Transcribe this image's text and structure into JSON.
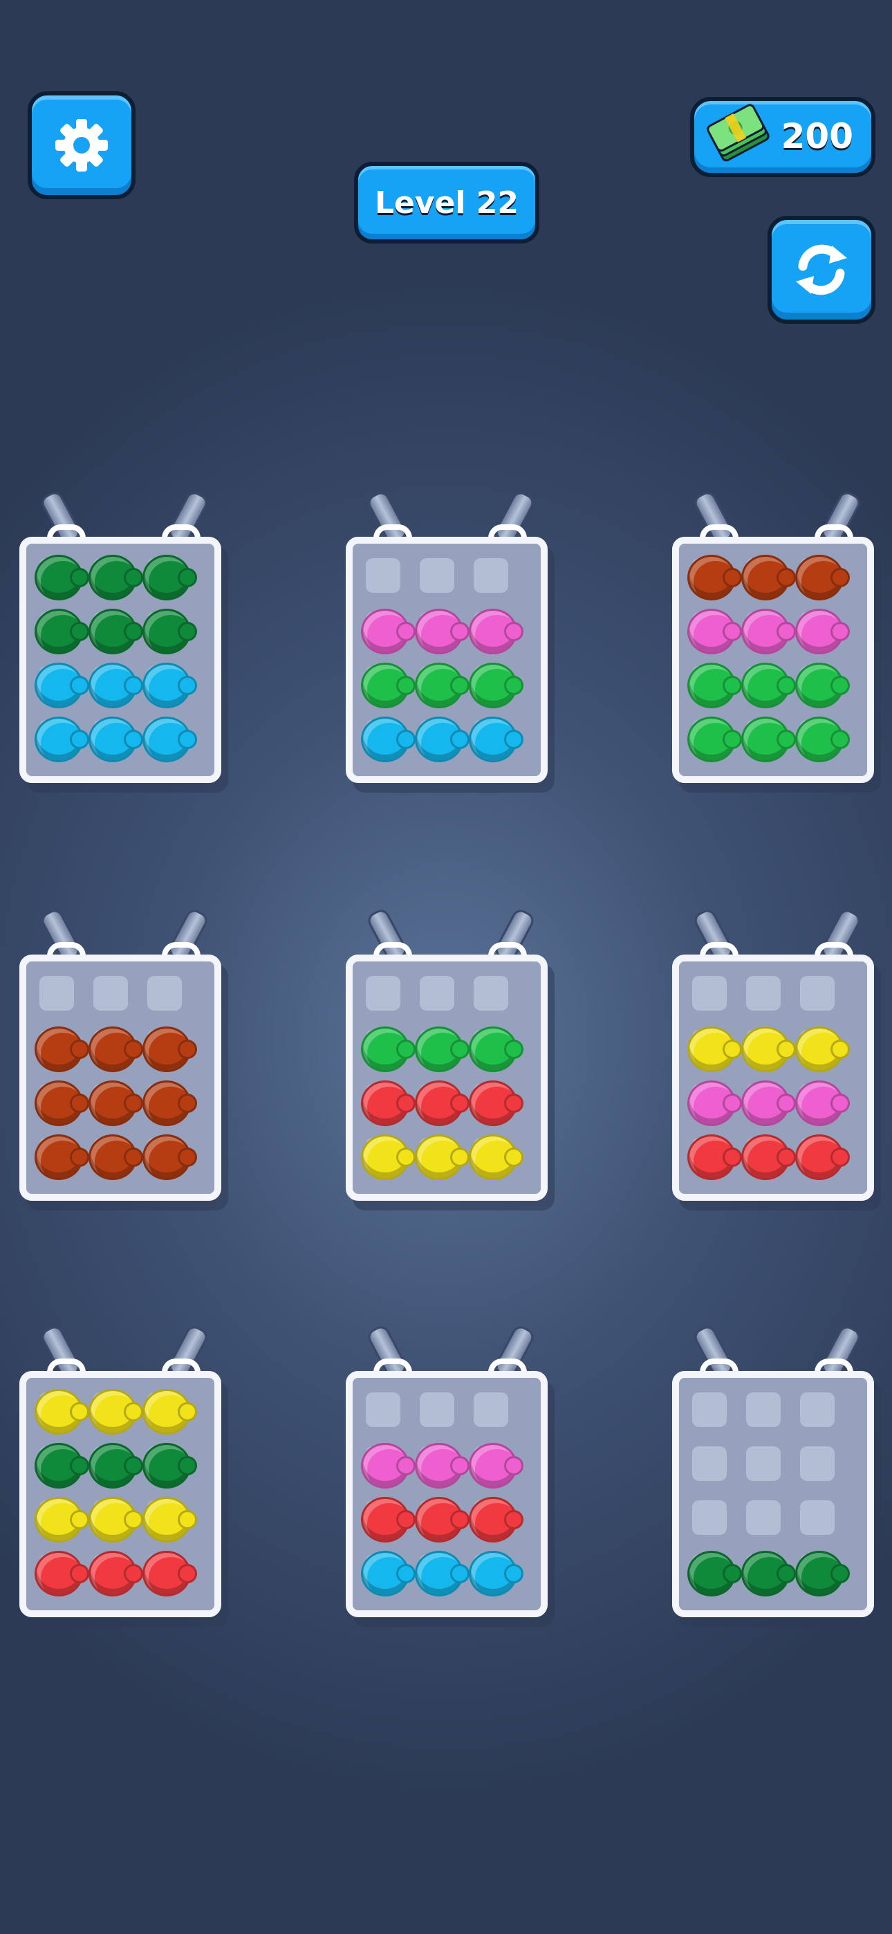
{
  "hud": {
    "level_label": "Level 22",
    "cash_amount": "200",
    "settings_icon": "gear-icon",
    "restart_icon": "refresh-icon",
    "cash_icon": "cash-stack-icon"
  },
  "colors": {
    "green": "#0f8a3a",
    "lime": "#1fc04a",
    "cyan": "#15b8ee",
    "pink": "#ee5fd0",
    "brown": "#b63d12",
    "red": "#f03a3f",
    "yellow": "#f2e21a"
  },
  "boards": [
    {
      "rows": [
        [
          "green",
          "green",
          "green"
        ],
        [
          "green",
          "green",
          "green"
        ],
        [
          "cyan",
          "cyan",
          "cyan"
        ],
        [
          "cyan",
          "cyan",
          "cyan"
        ]
      ]
    },
    {
      "rows": [
        [
          null,
          null,
          null
        ],
        [
          "pink",
          "pink",
          "pink"
        ],
        [
          "lime",
          "lime",
          "lime"
        ],
        [
          "cyan",
          "cyan",
          "cyan"
        ]
      ]
    },
    {
      "rows": [
        [
          "brown",
          "brown",
          "brown"
        ],
        [
          "pink",
          "pink",
          "pink"
        ],
        [
          "lime",
          "lime",
          "lime"
        ],
        [
          "lime",
          "lime",
          "lime"
        ]
      ]
    },
    {
      "rows": [
        [
          null,
          null,
          null
        ],
        [
          "brown",
          "brown",
          "brown"
        ],
        [
          "brown",
          "brown",
          "brown"
        ],
        [
          "brown",
          "brown",
          "brown"
        ]
      ]
    },
    {
      "rows": [
        [
          null,
          null,
          null
        ],
        [
          "lime",
          "lime",
          "lime"
        ],
        [
          "red",
          "red",
          "red"
        ],
        [
          "yellow",
          "yellow",
          "yellow"
        ]
      ]
    },
    {
      "rows": [
        [
          null,
          null,
          null
        ],
        [
          "yellow",
          "yellow",
          "yellow"
        ],
        [
          "pink",
          "pink",
          "pink"
        ],
        [
          "red",
          "red",
          "red"
        ]
      ]
    },
    {
      "rows": [
        [
          "yellow",
          "yellow",
          "yellow"
        ],
        [
          "green",
          "green",
          "green"
        ],
        [
          "yellow",
          "yellow",
          "yellow"
        ],
        [
          "red",
          "red",
          "red"
        ]
      ]
    },
    {
      "rows": [
        [
          null,
          null,
          null
        ],
        [
          "pink",
          "pink",
          "pink"
        ],
        [
          "red",
          "red",
          "red"
        ],
        [
          "cyan",
          "cyan",
          "cyan"
        ]
      ]
    },
    {
      "rows": [
        [
          null,
          null,
          null
        ],
        [
          null,
          null,
          null
        ],
        [
          null,
          null,
          null
        ],
        [
          "green",
          "green",
          "green"
        ]
      ]
    }
  ]
}
